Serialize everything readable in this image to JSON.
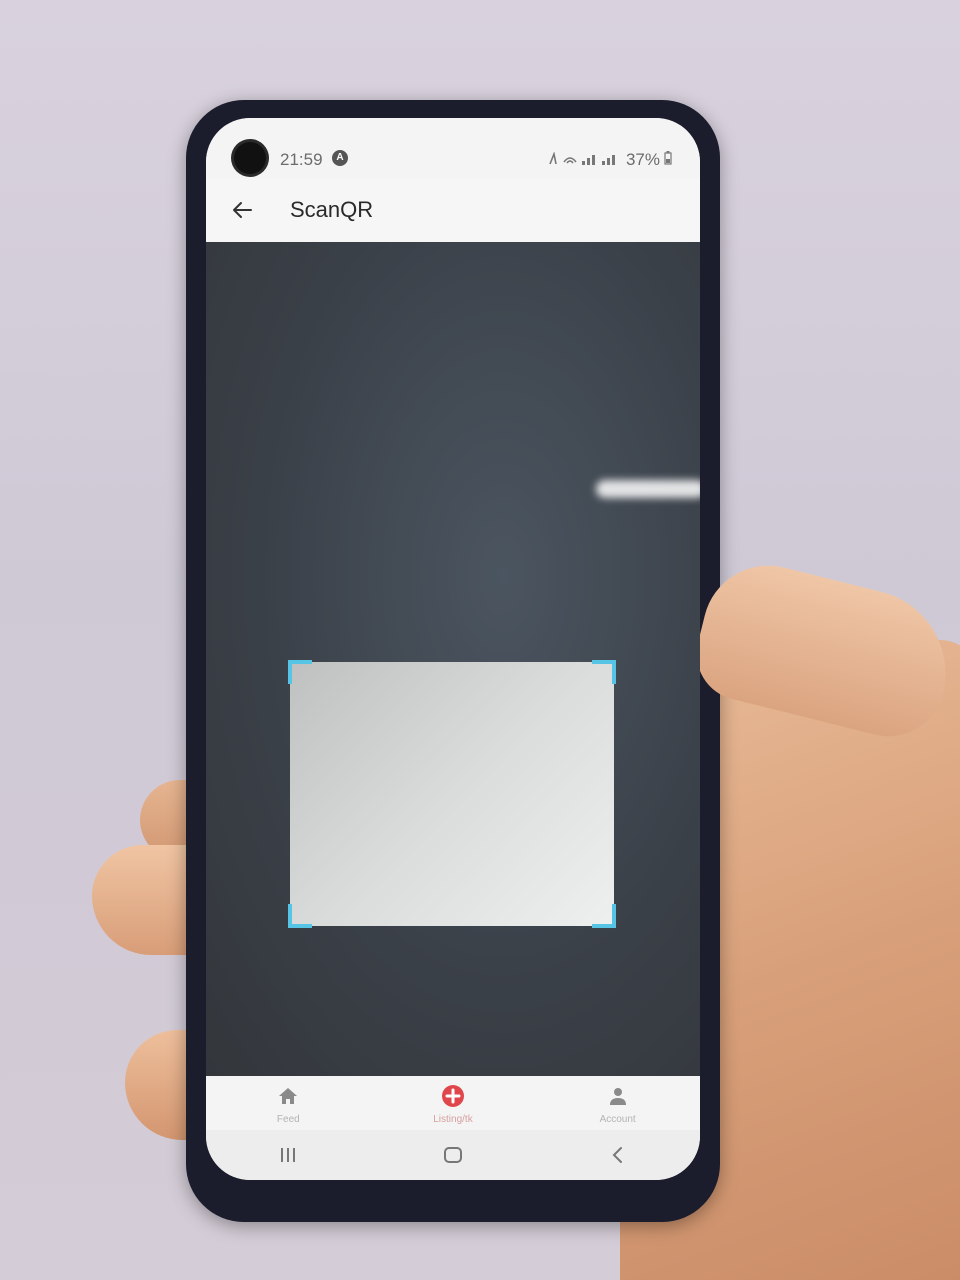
{
  "status_bar": {
    "time": "21:59",
    "app_icon": "app-notification-icon",
    "signal_icons": "✕✉ ◞.◞.",
    "battery": "37%"
  },
  "app_bar": {
    "back_icon": "arrow-left-icon",
    "title": "ScanQR"
  },
  "scanner": {
    "accent_color": "#56c4e4"
  },
  "bottom_nav": {
    "items": [
      {
        "label": "Feed",
        "icon": "home-icon"
      },
      {
        "label": "Listing/tk",
        "icon": "add-circle-icon",
        "active": true
      },
      {
        "label": "Account",
        "icon": "person-icon"
      }
    ],
    "active_color": "#e0474c"
  },
  "system_nav": {
    "recents_icon": "recents-icon",
    "home_icon": "home-outline-icon",
    "back_icon": "back-chevron-icon"
  }
}
